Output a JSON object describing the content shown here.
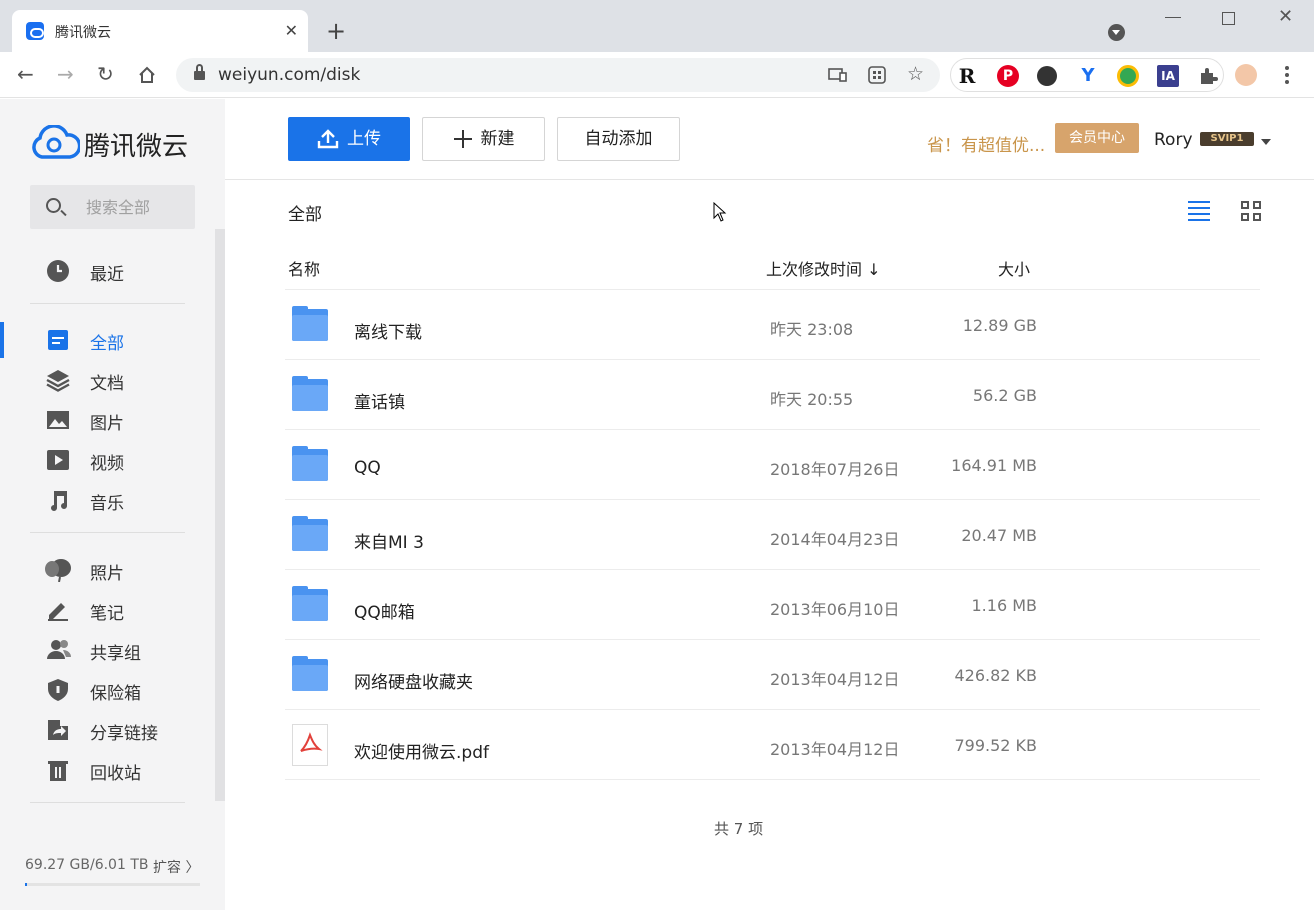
{
  "browser": {
    "tab_title": "腾讯微云",
    "url": "weiyun.com/disk",
    "new_tab_symbol": "+",
    "close_symbol": "✕"
  },
  "sidebar": {
    "logo_text": "腾讯微云",
    "search_placeholder": "搜索全部",
    "items": [
      {
        "label": "最近",
        "icon": "clock-icon"
      },
      {
        "label": "全部",
        "icon": "all-files-icon"
      },
      {
        "label": "文档",
        "icon": "layers-icon"
      },
      {
        "label": "图片",
        "icon": "image-icon"
      },
      {
        "label": "视频",
        "icon": "video-icon"
      },
      {
        "label": "音乐",
        "icon": "music-icon"
      },
      {
        "label": "照片",
        "icon": "balloon-icon"
      },
      {
        "label": "笔记",
        "icon": "pen-icon"
      },
      {
        "label": "共享组",
        "icon": "users-icon"
      },
      {
        "label": "保险箱",
        "icon": "shield-icon"
      },
      {
        "label": "分享链接",
        "icon": "share-icon"
      },
      {
        "label": "回收站",
        "icon": "trash-icon"
      }
    ],
    "quota": "69.27 GB/6.01 TB",
    "quota_used_fraction": 0.011,
    "expand_label": "扩容 〉"
  },
  "toolbar": {
    "upload_label": "上传",
    "new_label": "新建",
    "auto_add_label": "自动添加",
    "promo": "省！有超值优...",
    "member_center": "会员中心",
    "user_name": "Rory",
    "vip_badge": "SVIP1"
  },
  "main": {
    "breadcrumb": "全部",
    "columns": {
      "name": "名称",
      "modified": "上次修改时间 ↓",
      "size": "大小"
    },
    "files": [
      {
        "name": "离线下载",
        "modified": "昨天 23:08",
        "size": "12.89 GB",
        "type": "folder"
      },
      {
        "name": "童话镇",
        "modified": "昨天 20:55",
        "size": "56.2 GB",
        "type": "folder"
      },
      {
        "name": "QQ",
        "modified": "2018年07月26日",
        "size": "164.91 MB",
        "type": "folder"
      },
      {
        "name": "来自MI 3",
        "modified": "2014年04月23日",
        "size": "20.47 MB",
        "type": "folder"
      },
      {
        "name": "QQ邮箱",
        "modified": "2013年06月10日",
        "size": "1.16 MB",
        "type": "folder"
      },
      {
        "name": "网络硬盘收藏夹",
        "modified": "2013年04月12日",
        "size": "426.82 KB",
        "type": "folder"
      },
      {
        "name": "欢迎使用微云.pdf",
        "modified": "2013年04月12日",
        "size": "799.52 KB",
        "type": "pdf"
      }
    ],
    "total": "共 7 项"
  },
  "colors": {
    "accent": "#1a73e8",
    "folder": "#6aa8f7",
    "promo": "#c9954b",
    "member": "#d7a46c"
  }
}
